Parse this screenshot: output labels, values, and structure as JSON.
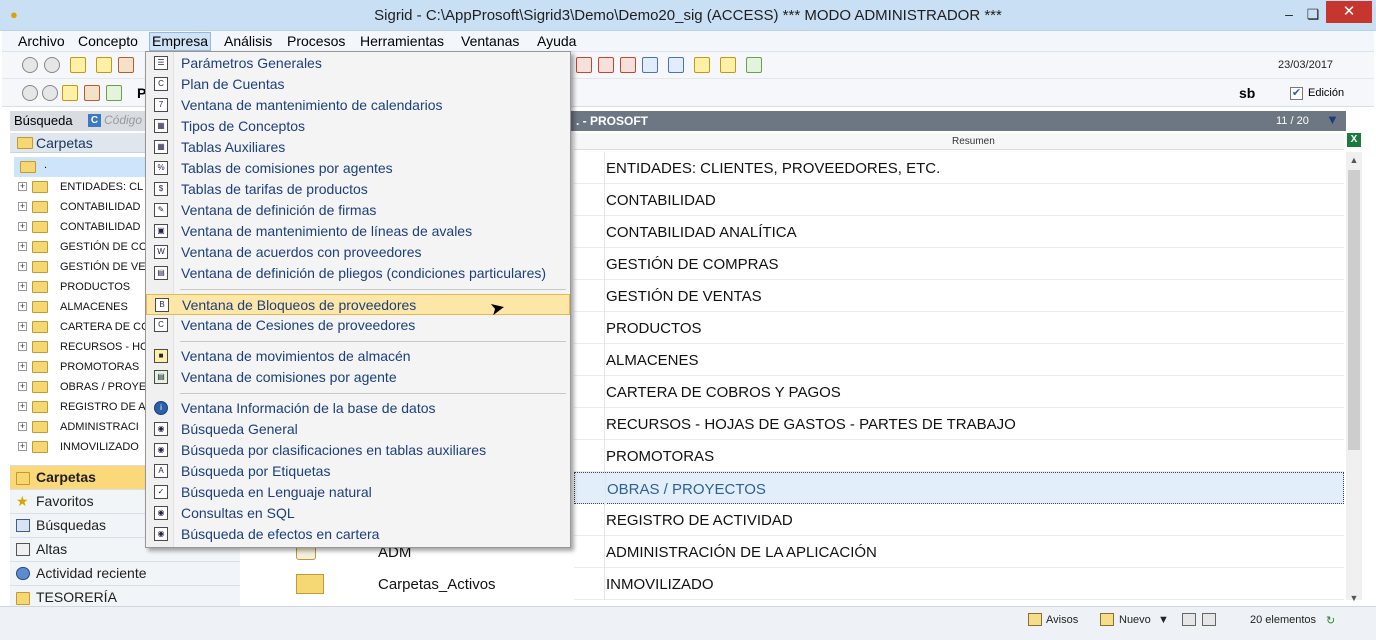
{
  "window": {
    "title": "Sigrid - C:\\AppProsoft\\Sigrid3\\Demo\\Demo20_sig (ACCESS)      *** MODO ADMINISTRADOR ***",
    "minimize": "–",
    "restore": "❏",
    "close": "✕"
  },
  "menubar": [
    "Archivo",
    "Concepto",
    "Empresa",
    "Análisis",
    "Procesos",
    "Herramientas",
    "Ventanas",
    "Ayuda"
  ],
  "toolbar": {
    "date": "23/03/2017",
    "user": "sb",
    "edicion_label": "Edición",
    "edicion_checked": "✔",
    "p_label": "P"
  },
  "search": {
    "label": "Búsqueda",
    "code_badge": "C",
    "placeholder": "Código"
  },
  "grid": {
    "title": ". - PROSOFT",
    "count": "11 / 20",
    "column_resumen": "Resumen",
    "rows": [
      "ENTIDADES: CLIENTES, PROVEEDORES, ETC.",
      "CONTABILIDAD",
      "CONTABILIDAD ANALÍTICA",
      "GESTIÓN DE COMPRAS",
      "GESTIÓN DE VENTAS",
      "PRODUCTOS",
      "ALMACENES",
      "CARTERA DE COBROS Y PAGOS",
      "RECURSOS - HOJAS DE GASTOS - PARTES DE TRABAJO",
      "PROMOTORAS",
      "OBRAS / PROYECTOS",
      "REGISTRO DE ACTIVIDAD",
      "ADMINISTRACIÓN DE LA APLICACIÓN",
      "INMOVILIZADO"
    ],
    "selected_row": "OBRAS / PROYECTOS",
    "lower_names": [
      "ADM",
      "Carpetas_Activos"
    ]
  },
  "tree": {
    "header": "Carpetas",
    "root": ".",
    "items": [
      "ENTIDADES: CL",
      "CONTABILIDAD",
      "CONTABILIDAD",
      "GESTIÓN DE CC",
      "GESTIÓN DE VE",
      "PRODUCTOS",
      "ALMACENES",
      "CARTERA DE CC",
      "RECURSOS - HC",
      "PROMOTORAS",
      "OBRAS / PROYE",
      "REGISTRO DE A",
      "ADMINISTRACI",
      "INMOVILIZADO"
    ]
  },
  "nav": [
    "Carpetas",
    "Favoritos",
    "Búsquedas",
    "Altas",
    "Actividad reciente",
    "TESORERÍA"
  ],
  "empresa_menu": {
    "groups": [
      [
        "Parámetros Generales",
        "Plan de Cuentas",
        "Ventana de mantenimiento de calendarios",
        "Tipos de Conceptos",
        "Tablas Auxiliares",
        "Tablas de comisiones por agentes",
        "Tablas de tarifas de productos",
        "Ventana de definición de firmas",
        "Ventana de mantenimiento de líneas de avales",
        "Ventana de acuerdos con proveedores",
        "Ventana de definición de pliegos (condiciones particulares)"
      ],
      [
        "Ventana de Bloqueos de proveedores",
        "Ventana de Cesiones de proveedores"
      ],
      [
        "Ventana de movimientos de almacén",
        "Ventana de comisiones por agente"
      ],
      [
        "Ventana Información de la base de datos",
        "Búsqueda General",
        "Búsqueda por clasificaciones en tablas auxiliares",
        "Búsqueda por Etiquetas",
        "Búsqueda en Lenguaje natural",
        "Consultas en SQL",
        "Búsqueda de efectos en cartera"
      ]
    ],
    "highlighted": "Ventana de Bloqueos de proveedores"
  },
  "status": {
    "avisos": "Avisos",
    "nuevo": "Nuevo",
    "elementos": "20 elementos"
  },
  "colors": {
    "accent": "#fbd97b",
    "menu_text": "#1c3f7a",
    "grid_header": "#6d7784",
    "close": "#c7362e"
  }
}
